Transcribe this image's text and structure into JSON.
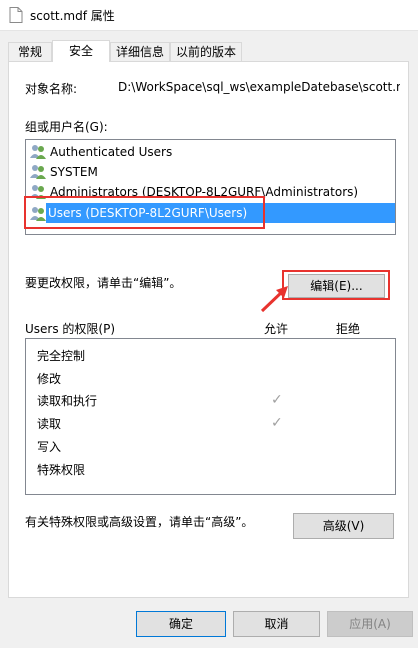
{
  "window": {
    "title": "scott.mdf 属性"
  },
  "tabs": [
    {
      "label": "常规"
    },
    {
      "label": "安全"
    },
    {
      "label": "详细信息"
    },
    {
      "label": "以前的版本"
    }
  ],
  "security": {
    "object_name_label": "对象名称:",
    "object_name_value": "D:\\WorkSpace\\sql_ws\\exampleDatebase\\scott.m",
    "group_label": "组或用户名(G):",
    "users": [
      {
        "name": "Authenticated Users"
      },
      {
        "name": "SYSTEM"
      },
      {
        "name": "Administrators (DESKTOP-8L2GURF\\Administrators)"
      },
      {
        "name": "Users (DESKTOP-8L2GURF\\Users)"
      }
    ],
    "edit_hint": "要更改权限，请单击“编辑”。",
    "edit_button": "编辑(E)...",
    "perm_label": "Users 的权限(P)",
    "allow_header": "允许",
    "deny_header": "拒绝",
    "permissions": [
      {
        "name": "完全控制",
        "allow": false
      },
      {
        "name": "修改",
        "allow": false
      },
      {
        "name": "读取和执行",
        "allow": true
      },
      {
        "name": "读取",
        "allow": true
      },
      {
        "name": "写入",
        "allow": false
      },
      {
        "name": "特殊权限",
        "allow": false
      }
    ],
    "advanced_hint": "有关特殊权限或高级设置，请单击“高级”。",
    "advanced_button": "高级(V)"
  },
  "footer": {
    "ok_button": "确定",
    "cancel_button": "取消",
    "apply_button": "应用(A)"
  },
  "colors": {
    "selection": "#3399ff",
    "annotation": "#e8332e"
  }
}
